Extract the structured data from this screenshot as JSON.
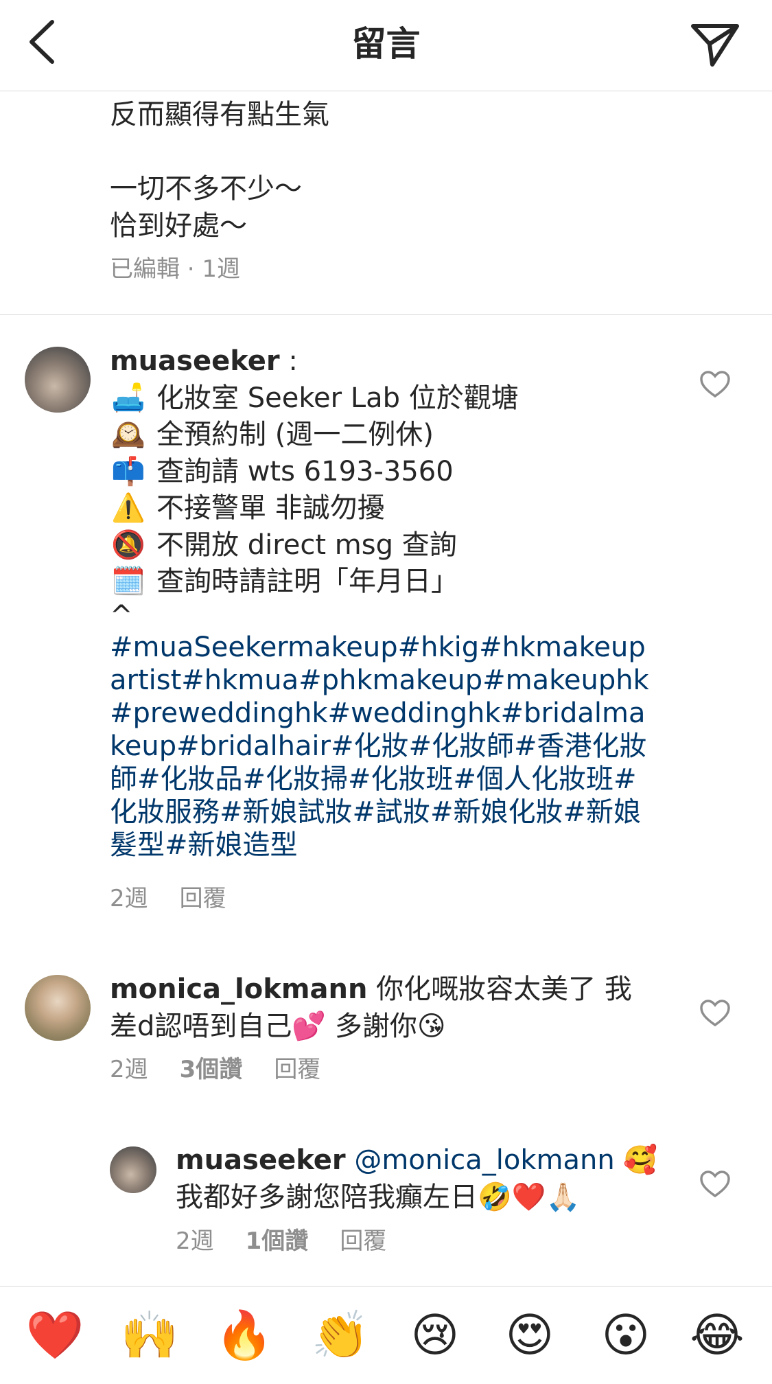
{
  "header": {
    "title": "留言",
    "back_icon": "chevron-left-icon",
    "send_icon": "paper-plane-icon"
  },
  "previous_comment": {
    "text": "反而顯得有點生氣\n\n一切不多不少～\n恰到好處～",
    "meta": "已編輯 · 1週"
  },
  "comments": [
    {
      "username": "muaseeker",
      "separator": " :",
      "lines": [
        {
          "emoji": "🛋️",
          "text": "化妝室 Seeker Lab 位於觀塘"
        },
        {
          "emoji": "🕰️",
          "text": "全預約制 (週一二例休)"
        },
        {
          "emoji": "📫",
          "text": "查詢請 wts 6193-3560"
        },
        {
          "emoji": "⚠️",
          "text": "不接警單 非誠勿擾"
        },
        {
          "emoji": "🔕",
          "text": "不開放 direct msg 查詢"
        },
        {
          "emoji": "🗓️",
          "text": "查詢時請註明「年月日」"
        }
      ],
      "caret": "^",
      "hashtags": "#muaSeekermakeup#hkig#hkmakeupartist#hkmua#phkmakeup#makeuphk#preweddinghk#weddinghk#bridalmakeup#bridalhair#化妝#化妝師#香港化妝師#化妝品#化妝掃#化妝班#個人化妝班#化妝服務#新娘試妝#試妝#新娘化妝#新娘髮型#新娘造型",
      "time": "2週",
      "reply": "回覆"
    },
    {
      "username": "monica_lokmann",
      "text_line1": " 你化嘅妝容太美了 我",
      "text_line2": "差d認唔到自己💕 多謝你😘",
      "time": "2週",
      "likes": "3個讚",
      "reply": "回覆"
    },
    {
      "username": "muaseeker",
      "mention": "@monica_lokmann",
      "mention_emoji": " 🥰",
      "text_line2": "我都好多謝您陪我癲左日🤣❤️🙏🏻",
      "time": "2週",
      "likes": "1個讚",
      "reply": "回覆"
    }
  ],
  "emoji_bar": [
    "❤️",
    "🙌",
    "🔥",
    "👏",
    "😢",
    "😍",
    "😮",
    "😂"
  ],
  "colors": {
    "link": "#00376b",
    "meta": "#8e8e8e",
    "text": "#262626",
    "divider": "#dbdbdb"
  }
}
